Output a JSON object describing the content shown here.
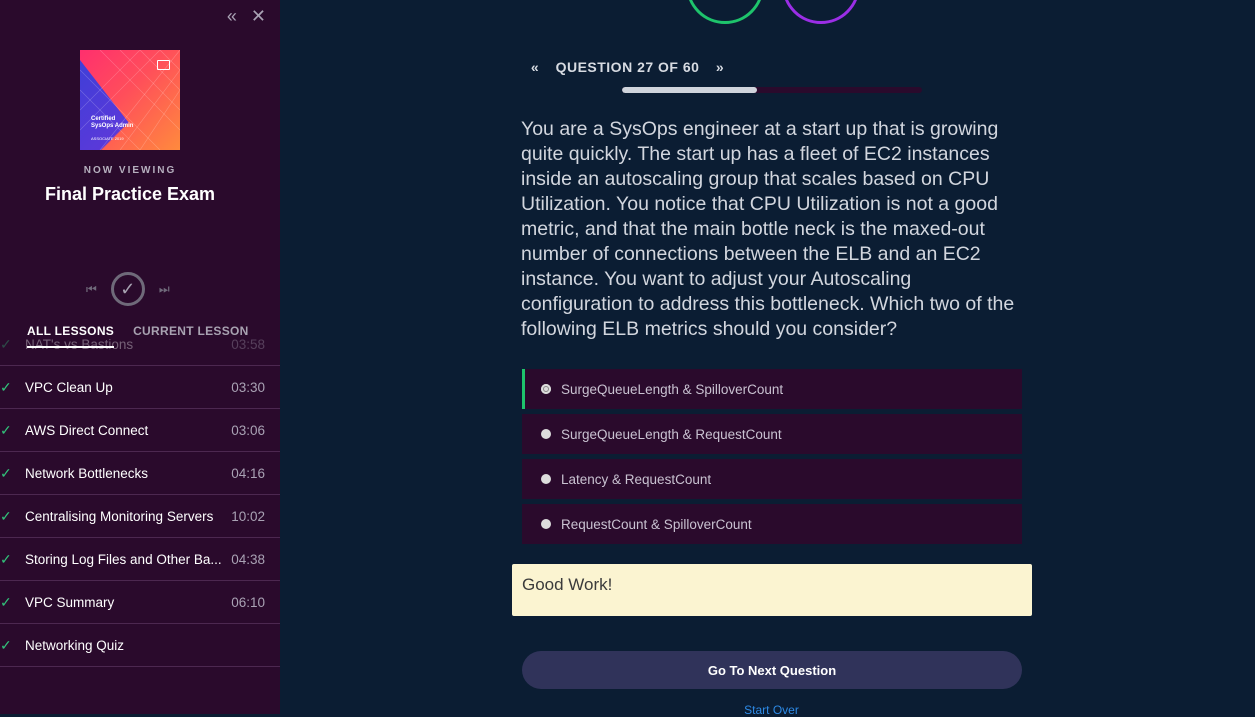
{
  "sidebar": {
    "cover": {
      "line1": "Certified",
      "line2": "SysOps Admin",
      "line3": "ASSOCIATE 2019"
    },
    "now_viewing": "NOW VIEWING",
    "title": "Final Practice Exam",
    "tabs": [
      {
        "label": "ALL LESSONS",
        "active": true
      },
      {
        "label": "CURRENT LESSON",
        "active": false
      }
    ],
    "lessons": [
      {
        "name": "NAT's vs Bastions",
        "duration": "03:58"
      },
      {
        "name": "VPC Clean Up",
        "duration": "03:30"
      },
      {
        "name": "AWS Direct Connect",
        "duration": "03:06"
      },
      {
        "name": "Network Bottlenecks",
        "duration": "04:16"
      },
      {
        "name": "Centralising Monitoring Servers",
        "duration": "10:02"
      },
      {
        "name": "Storing Log Files and Other Ba...",
        "duration": "04:38"
      },
      {
        "name": "VPC Summary",
        "duration": "06:10"
      },
      {
        "name": "Networking Quiz",
        "duration": ""
      }
    ]
  },
  "quiz": {
    "question_label": "QUESTION 27 OF 60",
    "progress": 0.45,
    "question_text": "You are a SysOps engineer at a start up that is growing quite quickly. The start up has a fleet of EC2 instances inside an autoscaling group that scales based on CPU Utilization. You notice that CPU Utilization is not a good metric, and that the main bottle neck is the maxed-out number of connections between the ELB and an EC2 instance. You want to adjust your Autoscaling configuration to address this bottleneck. Which two of the following ELB metrics should you consider?",
    "options": [
      {
        "label": "SurgeQueueLength & SpilloverCount",
        "selected": true
      },
      {
        "label": "SurgeQueueLength & RequestCount",
        "selected": false
      },
      {
        "label": "Latency & RequestCount",
        "selected": false
      },
      {
        "label": "RequestCount & SpilloverCount",
        "selected": false
      }
    ],
    "feedback": "Good Work!",
    "next_button": "Go To Next Question",
    "start_over": "Start Over"
  },
  "colors": {
    "sidebar_bg": "#2a0a2c",
    "main_bg": "#0b1d33",
    "accent_green": "#1ec46c",
    "accent_purple": "#9b2ee6",
    "feedback_bg": "#fbf4d1",
    "button_bg": "#30335a"
  }
}
